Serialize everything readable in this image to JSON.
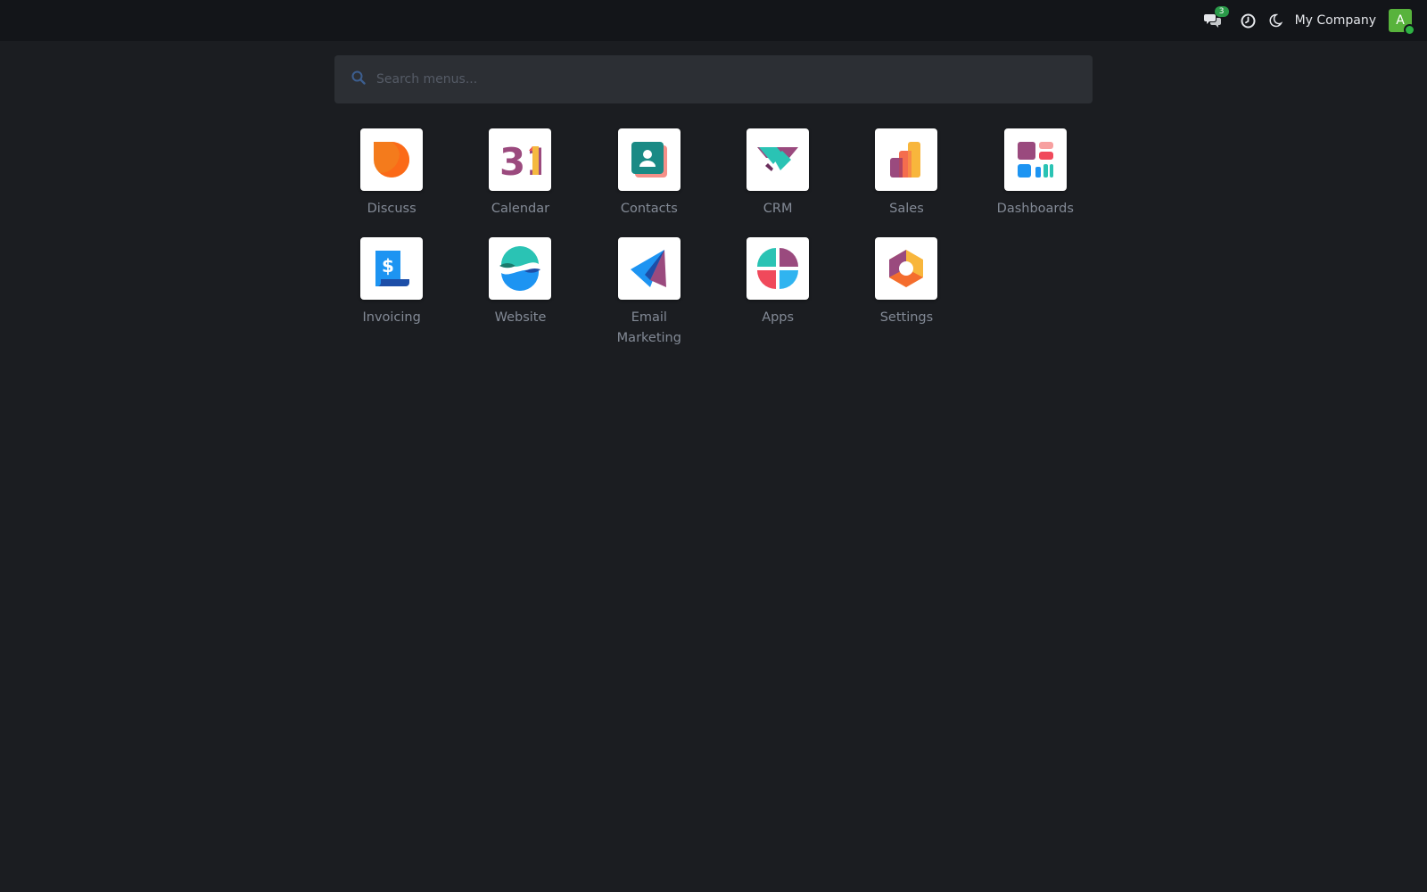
{
  "topbar": {
    "messages_icon": "chat-bubbles-icon",
    "messages_count": "3",
    "activity_icon": "clock-icon",
    "theme_icon": "moon-icon",
    "company_name": "My Company",
    "avatar_initial": "A",
    "avatar_color": "#58b33c"
  },
  "search": {
    "icon": "search-icon",
    "placeholder": "Search menus...",
    "value": ""
  },
  "apps": [
    {
      "label": "Discuss",
      "icon": "discuss-icon"
    },
    {
      "label": "Calendar",
      "icon": "calendar-icon",
      "icon_text": "31"
    },
    {
      "label": "Contacts",
      "icon": "contacts-icon"
    },
    {
      "label": "CRM",
      "icon": "crm-icon"
    },
    {
      "label": "Sales",
      "icon": "sales-icon"
    },
    {
      "label": "Dashboards",
      "icon": "dashboards-icon"
    },
    {
      "label": "Invoicing",
      "icon": "invoicing-icon",
      "icon_text": "$"
    },
    {
      "label": "Website",
      "icon": "website-icon"
    },
    {
      "label": "Email Marketing",
      "icon": "email-marketing-icon"
    },
    {
      "label": "Apps",
      "icon": "apps-icon"
    },
    {
      "label": "Settings",
      "icon": "settings-icon"
    }
  ]
}
